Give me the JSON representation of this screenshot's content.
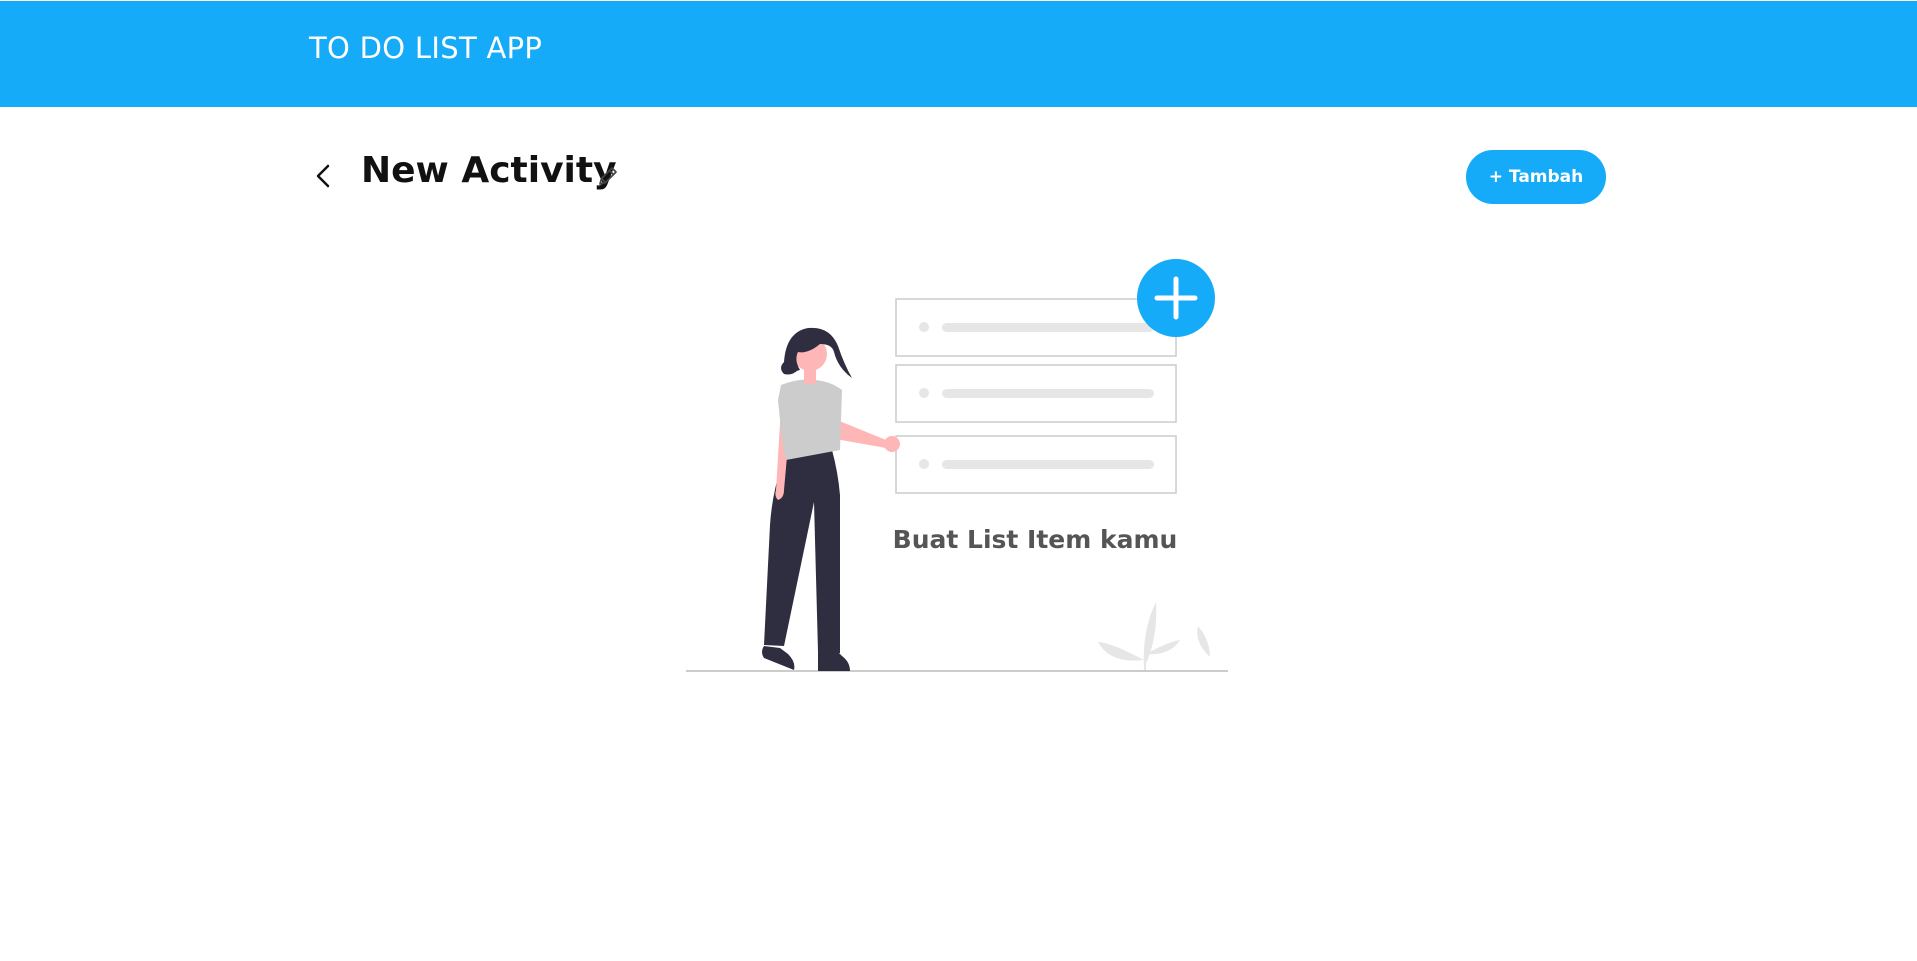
{
  "header": {
    "app_title": "TO DO LIST APP"
  },
  "activity": {
    "title": "New Activity",
    "back_icon": "chevron-left-icon",
    "edit_icon": "pencil-icon"
  },
  "toolbar": {
    "add_label": "+ Tambah"
  },
  "empty_state": {
    "message": "Buat List Item kamu"
  },
  "colors": {
    "primary": "#16abf8",
    "text_dark": "#111111",
    "text_muted": "#555555",
    "figure_dark": "#2f2e41",
    "skin": "#ffb6b6",
    "shirt": "#cccccc",
    "placeholder_gray": "#e6e6e6"
  }
}
